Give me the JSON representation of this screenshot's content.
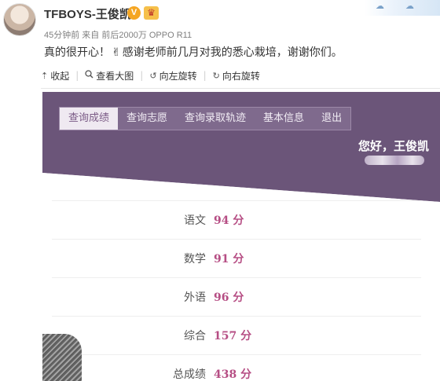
{
  "post": {
    "username": "TFBOYS-王俊凯",
    "verified_badge": "V",
    "meta": "45分钟前 来自 前后2000万 OPPO R11",
    "text_before_emoji": "真的很开心！",
    "emoji": "✌",
    "text_after_emoji": "感谢老师前几月对我的悉心栽培，谢谢你们。"
  },
  "toolbar": {
    "collapse": "收起",
    "view_large": "查看大图",
    "rotate_left": "向左旋转",
    "rotate_right": "向右旋转"
  },
  "photo": {
    "nav": [
      "查询成绩",
      "查询志愿",
      "查询录取轨迹",
      "基本信息",
      "退出"
    ],
    "active_nav_index": 0,
    "greeting": "您好，王俊凯",
    "grades": [
      {
        "subject": "语文",
        "score": "94 分"
      },
      {
        "subject": "数学",
        "score": "91 分"
      },
      {
        "subject": "外语",
        "score": "96 分"
      },
      {
        "subject": "综合",
        "score": "157 分"
      },
      {
        "subject": "总成绩",
        "score": "438 分"
      }
    ]
  },
  "colors": {
    "header_purple": "#6b5579",
    "score_pink": "#b64e84",
    "vip_orange": "#f5a623"
  },
  "icons": {
    "collapse": "collapse-arrow-icon",
    "view_large": "magnifier-icon",
    "rotate_left": "rotate-left-icon",
    "rotate_right": "rotate-right-icon"
  }
}
